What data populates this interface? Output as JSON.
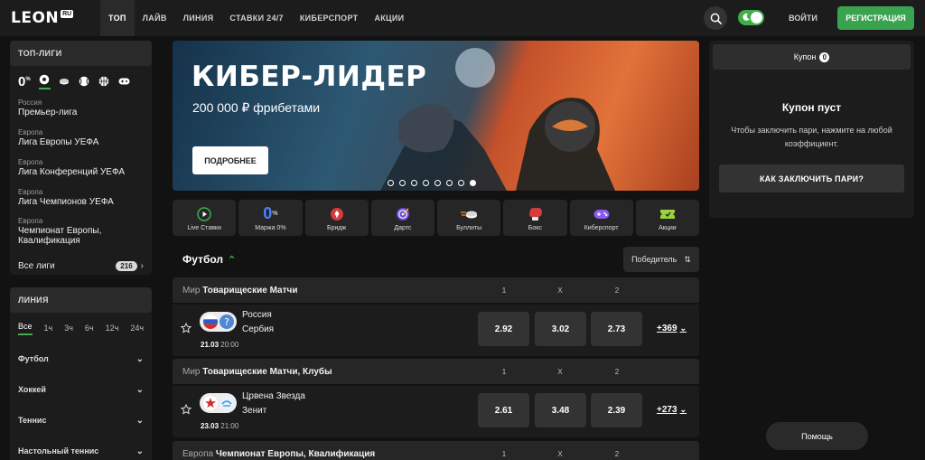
{
  "nav": {
    "logo": "LEON",
    "logo_badge": "RU",
    "tabs": [
      "ТОП",
      "ЛАЙВ",
      "ЛИНИЯ",
      "СТАВКИ 24/7",
      "КИБЕРСПОРТ",
      "АКЦИИ"
    ],
    "login": "ВОЙТИ",
    "register": "РЕГИСТРАЦИЯ",
    "accent": "#3aa34f"
  },
  "sidebar": {
    "top_leagues_title": "ТОП-ЛИГИ",
    "zero": "0",
    "zero_sup": "%",
    "leagues": [
      {
        "region": "Россия",
        "name": "Премьер-лига"
      },
      {
        "region": "Европа",
        "name": "Лига Европы УЕФА"
      },
      {
        "region": "Европа",
        "name": "Лига Конференций УЕФА"
      },
      {
        "region": "Европа",
        "name": "Лига Чемпионов УЕФА"
      },
      {
        "region": "Европа",
        "name": "Чемпионат Европы,",
        "name2": "Квалификация"
      }
    ],
    "all_leagues": "Все лиги",
    "all_leagues_count": "216",
    "line_title": "ЛИНИЯ",
    "periods": [
      "Все",
      "1ч",
      "3ч",
      "6ч",
      "12ч",
      "24ч"
    ],
    "sports": [
      "Футбол",
      "Хоккей",
      "Теннис",
      "Настольный теннис"
    ]
  },
  "banner": {
    "title": "КИБЕР-ЛИДЕР",
    "subtitle": "200 000 ₽ фрибетами",
    "button": "ПОДРОБНЕЕ",
    "slide_count": 8,
    "active_slide": 8
  },
  "tiles": [
    {
      "label": "Live Ставки",
      "icon": "play-circle-icon"
    },
    {
      "label": "Маржа 0%",
      "icon": "zero-percent-icon",
      "zero": "0",
      "sup": "%"
    },
    {
      "label": "Бридж",
      "icon": "cards-spade-icon"
    },
    {
      "label": "Дартс",
      "icon": "darts-icon"
    },
    {
      "label": "Буллиты",
      "icon": "hockey-puck-icon"
    },
    {
      "label": "Бокс",
      "icon": "boxing-glove-icon"
    },
    {
      "label": "Киберспорт",
      "icon": "gamepad-icon"
    },
    {
      "label": "Акции",
      "icon": "ticket-icon"
    }
  ],
  "section": {
    "title": "Футбол",
    "sort": "Победитель"
  },
  "groups": [
    {
      "region": "Мир",
      "name": "Товарищеские Матчи",
      "headers": [
        "1",
        "X",
        "2"
      ],
      "match": {
        "team1": "Россия",
        "team2": "Сербия",
        "date": "21.03",
        "time": "20:00",
        "odds": [
          "2.92",
          "3.02",
          "2.73"
        ],
        "more": "+369"
      }
    },
    {
      "region": "Мир",
      "name": "Товарищеские Матчи, Клубы",
      "headers": [
        "1",
        "X",
        "2"
      ],
      "match": {
        "team1": "Црвена Звезда",
        "team2": "Зенит",
        "date": "23.03",
        "time": "21:00",
        "odds": [
          "2.61",
          "3.48",
          "2.39"
        ],
        "more": "+273"
      }
    },
    {
      "region": "Европа",
      "name": "Чемпионат Европы, Квалификация",
      "headers": [
        "1",
        "X",
        "2"
      ]
    }
  ],
  "coupon": {
    "tab": "Купон",
    "count": "0",
    "empty_title": "Купон пуст",
    "hint": "Чтобы заключить пари, нажмите на любой коэффициент.",
    "how_button": "КАК ЗАКЛЮЧИТЬ ПАРИ?"
  },
  "help": "Помощь"
}
